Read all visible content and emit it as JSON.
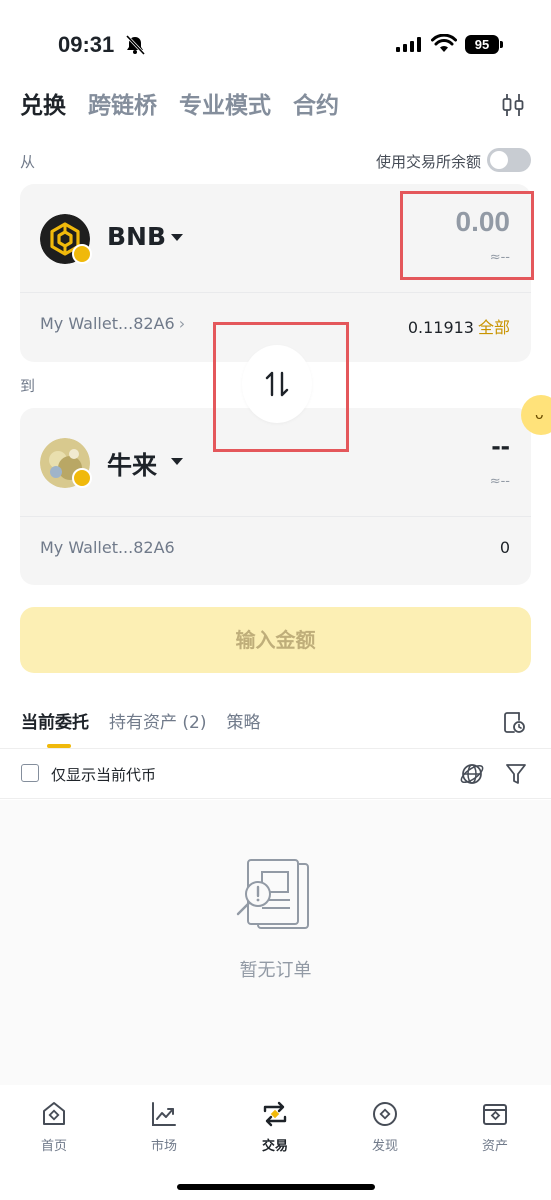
{
  "status_bar": {
    "time": "09:31",
    "battery": "95"
  },
  "header": {
    "tabs": [
      {
        "label": "兑换",
        "active": true
      },
      {
        "label": "跨链桥",
        "active": false
      },
      {
        "label": "专业模式",
        "active": false
      },
      {
        "label": "合约",
        "active": false
      }
    ]
  },
  "swap": {
    "from_label": "从",
    "balance_toggle_label": "使用交易所余额",
    "balance_toggle_on": false,
    "from": {
      "token": "BNB",
      "amount": "0.00",
      "approx": "≈--",
      "wallet": "My Wallet...82A6",
      "balance": "0.11913",
      "max_label": "全部"
    },
    "to_label": "到",
    "to": {
      "token": "牛来",
      "amount": "--",
      "approx": "≈--",
      "wallet": "My Wallet...82A6",
      "balance": "0"
    },
    "cta_label": "输入金额"
  },
  "orders": {
    "tabs": [
      {
        "label": "当前委托",
        "active": true
      },
      {
        "label": "持有资产 (2)",
        "active": false
      },
      {
        "label": "策略",
        "active": false
      }
    ],
    "filter_label": "仅显示当前代币",
    "filter_checked": false,
    "empty_text": "暂无订单"
  },
  "bottom_nav": [
    {
      "label": "首页",
      "icon": "home-icon",
      "active": false
    },
    {
      "label": "市场",
      "icon": "market-chart-icon",
      "active": false
    },
    {
      "label": "交易",
      "icon": "trade-swap-icon",
      "active": true
    },
    {
      "label": "发现",
      "icon": "discover-compass-icon",
      "active": false
    },
    {
      "label": "资产",
      "icon": "wallet-icon",
      "active": false
    }
  ],
  "colors": {
    "brand_yellow": "#f0b90b",
    "link_gold": "#c99400",
    "cta_disabled_bg": "#fcefb4",
    "annotation_red": "#e4575b"
  }
}
